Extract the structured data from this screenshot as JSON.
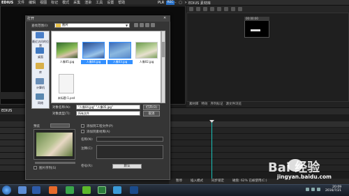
{
  "menubar": {
    "logo": "EDIUS",
    "items": [
      "文件",
      "编辑",
      "视图",
      "标记",
      "模式",
      "采集",
      "渲染",
      "工具",
      "设置",
      "帮助"
    ],
    "plr": "PLR",
    "rec": "REC"
  },
  "bin": {
    "title": "EDIUS 素材库",
    "tabs": [
      "素材库",
      "特效",
      "序列标记",
      "源文件浏览"
    ],
    "clip_label": "00:00:00"
  },
  "timeline": {
    "label": "EDIUS",
    "status_items": [
      "暂停",
      "插入模式",
      "同步锁定",
      "磁盘: 62% 已被使用(C:)"
    ]
  },
  "dialog": {
    "title": "打开",
    "look_in_label": "查找范围(I):",
    "look_in_value": "图片",
    "places": [
      "最近访问的位置",
      "桌面",
      "库",
      "计算机",
      "网络"
    ],
    "files": [
      {
        "name": "人像05.jpg",
        "selected": false
      },
      {
        "name": "人像04.jpg",
        "selected": true
      },
      {
        "name": "人像03.jpg",
        "selected": true
      },
      {
        "name": "人像02.jpg",
        "selected": false
      },
      {
        "name": "未标题-1.psd",
        "selected": false
      }
    ],
    "filename_label": "对象名称(N):",
    "filename_value": "\"人像04.jpg\" \"人像05.jpg\"",
    "filetype_label": "对象类型(T):",
    "filetype_value": "所有文件",
    "open_button": "打开(O)",
    "cancel_button": "取消",
    "preview_label": "预览",
    "checkbox_add_project": "添加到工程文件(P)",
    "checkbox_merge": "添加到素材库(A)",
    "checkbox_sequence": "图片序列(S)",
    "field_name": "名称(N):",
    "field_comment": "注释(C):",
    "field_reel": "卷号(R):",
    "open_bottom": "默认"
  },
  "taskbar": {
    "time": "20:09",
    "date": "2016/7/21",
    "ime": "CH"
  },
  "watermark": {
    "logo": "Bai  经验",
    "url": "jingyan.baidu.com"
  },
  "colors": {
    "accent": "#19c2b9",
    "selection": "#3390ff",
    "rec_badge": "#2a72c8"
  }
}
